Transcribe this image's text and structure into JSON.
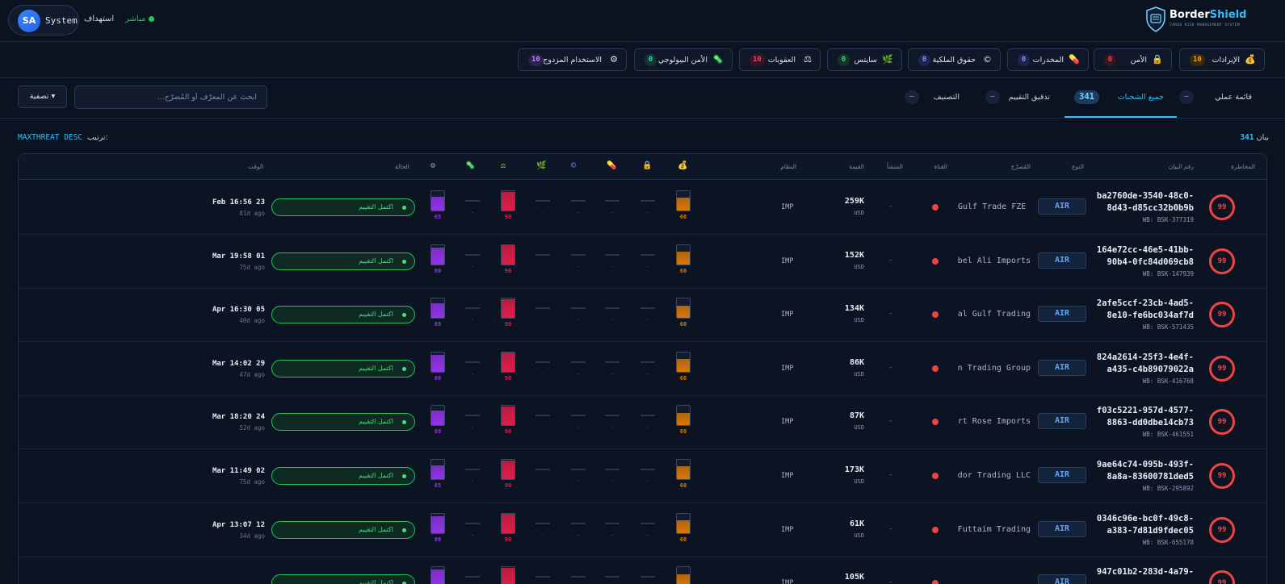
{
  "header": {
    "user_initials": "SA",
    "user_name": "System",
    "link_label": "استهداف",
    "live_label": "مباشر",
    "brand_name_a": "Border",
    "brand_name_b": "Shield",
    "brand_sub": "CARGO RISK MANAGEMENT SYSTEM"
  },
  "categories": [
    {
      "label": "الإيرادات",
      "icon": "money-bag-icon",
      "glyph": "💰",
      "count": "10",
      "count_bg": "#3b2a0e",
      "count_color": "#f59e0b"
    },
    {
      "label": "الأمن",
      "icon": "lock-icon",
      "glyph": "🔒",
      "count": "0",
      "count_bg": "#3a1420",
      "count_color": "#f43f5e"
    },
    {
      "label": "المخدرات",
      "icon": "pill-icon",
      "glyph": "💊",
      "count": "0",
      "count_bg": "#1e2450",
      "count_color": "#818cf8"
    },
    {
      "label": "حقوق الملكية",
      "icon": "copyright-icon",
      "glyph": "©",
      "count": "0",
      "count_bg": "#1e2450",
      "count_color": "#818cf8"
    },
    {
      "label": "سايتس",
      "icon": "leaf-icon",
      "glyph": "🌿",
      "count": "0",
      "count_bg": "#123524",
      "count_color": "#34d399"
    },
    {
      "label": "العقوبات",
      "icon": "scales-icon",
      "glyph": "⚖",
      "count": "10",
      "count_bg": "#3a1420",
      "count_color": "#f43f5e"
    },
    {
      "label": "الأمن البيولوجي",
      "icon": "microbe-icon",
      "glyph": "🦠",
      "count": "0",
      "count_bg": "#123530",
      "count_color": "#2dd4bf"
    },
    {
      "label": "الاستخدام المزدوج",
      "icon": "gear-icon",
      "glyph": "⚙",
      "count": "10",
      "count_bg": "#2e1f4a",
      "count_color": "#a78bfa"
    }
  ],
  "toolbar": {
    "filter_label": "تصفية ▾",
    "search_placeholder": "ابحث عن المعرّف أو المُصرّح...",
    "tabs": [
      {
        "label": "قائمة عملي",
        "count": "—"
      },
      {
        "label": "جميع الشحنات",
        "count": "341"
      },
      {
        "label": "تدقيق التقييم",
        "count": "—"
      },
      {
        "label": "التصنيف",
        "count": "—"
      }
    ]
  },
  "summary": {
    "sort_prefix": "ترتيب:",
    "sort_value": "MAXTHREAT DESC",
    "count_value": "341",
    "count_suffix": "بيان"
  },
  "columns": {
    "risk": "المخاطرة",
    "id": "رقم البيان",
    "type": "النوع",
    "declarant": "المُصرّح",
    "channel": "القناة",
    "origin": "المنشأ",
    "value": "القيمة",
    "regime": "النظام",
    "status": "الحالة",
    "time": "الوقت"
  },
  "colors": {
    "revenue_bar": "#d97706",
    "sanctions_bar": "#e11d48",
    "dual_use_bar": "#9333ea",
    "status_green": "#22c55e",
    "risk_red": "#ef4444",
    "accent": "#38bdf8"
  },
  "rows": [
    {
      "risk": "99",
      "id_a": "ba2760de-3540-48c0-",
      "id_b": "8d43-d85cc32b0b9b",
      "wb": "WB: BSK-377319",
      "type": "AIR",
      "declarant": "Gulf Trade FZE",
      "origin": "-",
      "value": "259K",
      "currency": "USD",
      "regime": "IMP",
      "revenue": 60,
      "sanctions": 90,
      "dual_use": 65,
      "status": "اكتمل التقييم",
      "time": "Feb 16:56 23",
      "ago": "81d ago"
    },
    {
      "risk": "99",
      "id_a": "164e72cc-46e5-41bb-",
      "id_b": "90b4-0fc84d069cb8",
      "wb": "WB: BSK-147939",
      "type": "AIR",
      "declarant": "Jebel Ali Imports",
      "origin": "-",
      "value": "152K",
      "currency": "USD",
      "regime": "IMP",
      "revenue": 60,
      "sanctions": 90,
      "dual_use": 80,
      "status": "اكتمل التقييم",
      "time": "Mar 19:58 01",
      "ago": "75d ago"
    },
    {
      "risk": "99",
      "id_a": "2afe5ccf-23cb-4ad5-",
      "id_b": "8e10-fe6bc034af7d",
      "wb": "WB: BSK-571435",
      "type": "AIR",
      "declarant": "Global Gulf Trading",
      "origin": "-",
      "value": "134K",
      "currency": "USD",
      "regime": "IMP",
      "revenue": 60,
      "sanctions": 90,
      "dual_use": 69,
      "status": "اكتمل التقييم",
      "time": "Apr 16:30 05",
      "ago": "40d ago"
    },
    {
      "risk": "99",
      "id_a": "824a2614-25f3-4e4f-",
      "id_b": "a435-c4b89079022a",
      "wb": "WB: BSK-416768",
      "type": "AIR",
      "declarant": "Falcon Trading Group",
      "origin": "-",
      "value": "86K",
      "currency": "USD",
      "regime": "IMP",
      "revenue": 60,
      "sanctions": 90,
      "dual_use": 80,
      "status": "اكتمل التقييم",
      "time": "Mar 14:02 29",
      "ago": "47d ago"
    },
    {
      "risk": "99",
      "id_a": "f03c5221-957d-4577-",
      "id_b": "8863-dd0dbe14cb73",
      "wb": "WB: BSK-461551",
      "type": "AIR",
      "declarant": "Desert Rose Imports",
      "origin": "-",
      "value": "87K",
      "currency": "USD",
      "regime": "IMP",
      "revenue": 60,
      "sanctions": 90,
      "dual_use": 69,
      "status": "اكتمل التقييم",
      "time": "Mar 18:20 24",
      "ago": "52d ago"
    },
    {
      "risk": "99",
      "id_a": "9ae64c74-095b-493f-",
      "id_b": "8a8a-83600781ded5",
      "wb": "WB: BSK-295892",
      "type": "AIR",
      "declarant": "Corridor Trading LLC",
      "origin": "-",
      "value": "173K",
      "currency": "USD",
      "regime": "IMP",
      "revenue": 60,
      "sanctions": 90,
      "dual_use": 65,
      "status": "اكتمل التقييم",
      "time": "Mar 11:49 02",
      "ago": "75d ago"
    },
    {
      "risk": "99",
      "id_a": "0346c96e-bc0f-49c8-",
      "id_b": "a383-7d81d9fdec05",
      "wb": "WB: BSK-655178",
      "type": "AIR",
      "declarant": "Al Futtaim Trading",
      "origin": "-",
      "value": "61K",
      "currency": "USD",
      "regime": "IMP",
      "revenue": 60,
      "sanctions": 90,
      "dual_use": 80,
      "status": "اكتمل التقييم",
      "time": "Apr 13:07 12",
      "ago": "34d ago"
    },
    {
      "risk": "99",
      "id_a": "947c01b2-283d-4a79-",
      "id_b": "",
      "wb": "",
      "type": "AIR",
      "declarant": "",
      "origin": "-",
      "value": "105K",
      "currency": "USD",
      "regime": "IMP",
      "revenue": 60,
      "sanctions": 90,
      "dual_use": 80,
      "status": "اكتمل التقييم",
      "time": "",
      "ago": ""
    }
  ]
}
